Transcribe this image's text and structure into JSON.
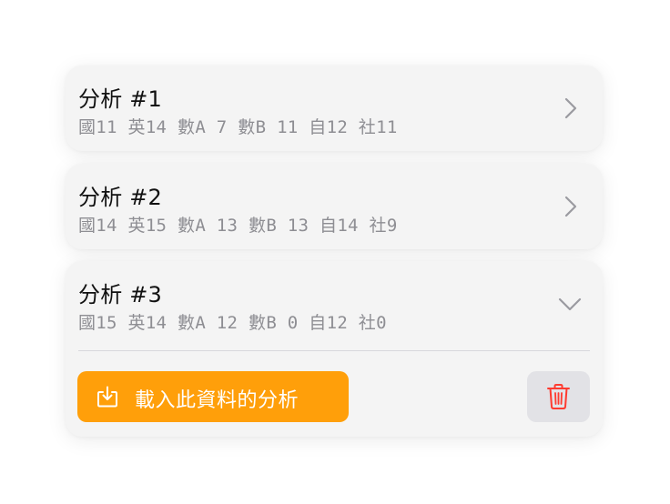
{
  "analyses": [
    {
      "title": "分析 #1",
      "scores": "國11 英14 數A 7 數B 11 自12 社11",
      "expanded": false,
      "chevron_icon": "chevron-right-icon"
    },
    {
      "title": "分析 #2",
      "scores": "國14 英15 數A 13 數B 13 自14 社9",
      "expanded": false,
      "chevron_icon": "chevron-right-icon"
    },
    {
      "title": "分析 #3",
      "scores": "國15 英14 數A 12 數B 0 自12 社0",
      "expanded": true,
      "chevron_icon": "chevron-down-icon"
    }
  ],
  "actions": {
    "load_label": "載入此資料的分析",
    "load_icon": "download-tray-icon",
    "delete_icon": "trash-icon"
  },
  "colors": {
    "accent": "#ff9f0a",
    "destructive": "#ff3b30",
    "secondary_text": "#8e8e93",
    "card_background": "#f4f4f4"
  }
}
